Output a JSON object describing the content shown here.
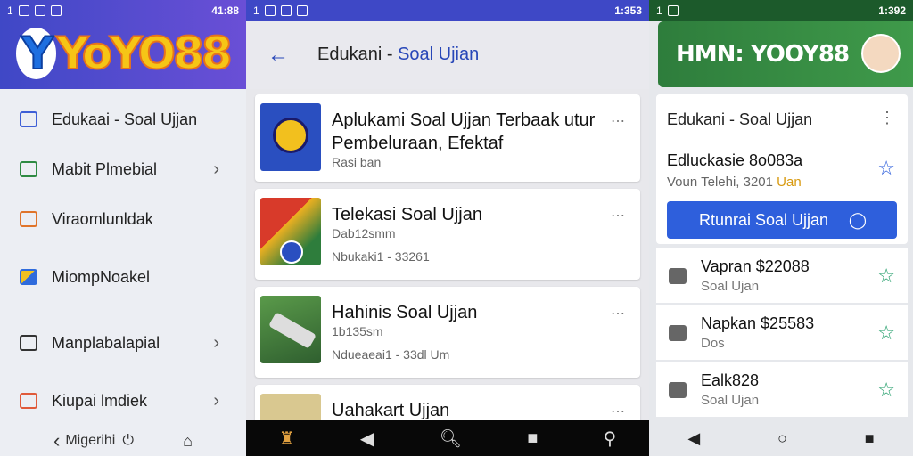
{
  "panel1": {
    "status_time": "41:88",
    "status_left": "1",
    "logo_y": "Y",
    "logo_rest": "YoYO88",
    "menu": [
      {
        "label": "Edukaai - Soal Ujjan",
        "icon": "card-icon",
        "color": "#3e5fd6"
      },
      {
        "label": "Mabit Plmebial",
        "icon": "book-icon",
        "color": "#2e8a42"
      },
      {
        "label": "Viraomlunldak",
        "icon": "folder-icon",
        "color": "#e0742a"
      },
      {
        "label": "MiompNoakel",
        "icon": "pencil-icon",
        "color": "#2f6bdc"
      },
      {
        "label": "Manplabalapial",
        "icon": "window-icon",
        "color": "#333333"
      },
      {
        "label": "Kiupai lmdiek",
        "icon": "list-icon",
        "color": "#e05a3a"
      }
    ],
    "footer_label": "Migerihi"
  },
  "panel2": {
    "status_time": "1:353",
    "status_left": "1",
    "title": "Edukani",
    "subtitle": "Soal Ujian",
    "cards": [
      {
        "title_line1": "Aplukami Soal Ujjan Terbaak utur",
        "title_line2": "Pembeluraan, Efektaf",
        "sub1": "Rasi ban",
        "sub2": ""
      },
      {
        "title_line1": "Telekasi Soal Ujjan",
        "title_line2": "",
        "sub1": "Dab12smm",
        "sub2": "Nbukaki1 - 33261"
      },
      {
        "title_line1": "Hahinis Soal Ujjan",
        "title_line2": "",
        "sub1": "1b135sm",
        "sub2": "Ndueaeai1 - 33dl Um"
      },
      {
        "title_line1": "Uahakart Ujjan",
        "title_line2": "",
        "sub1": "",
        "sub2": ""
      }
    ]
  },
  "panel3": {
    "status_time": "1:392",
    "status_left": "1",
    "banner_left": "HMN:",
    "banner_right": "YOOY88",
    "card_title": "Edukani - Soal Ujjan",
    "detail_title": "Edluckasie 8o083a",
    "detail_sub": "Voun Telehi, 3201",
    "detail_highlight": "Uan",
    "button_label": "Rtunrai Soal Ujjan",
    "rows": [
      {
        "title": "Vapran $22088",
        "sub": "Soal Ujan"
      },
      {
        "title": "Napkan $25583",
        "sub": "Dos"
      },
      {
        "title": "Ealk828",
        "sub": "Soal Ujan"
      }
    ]
  },
  "colors": {
    "primary": "#3e48c6",
    "green": "#2e7d3c",
    "accent_blue": "#2e5fdc",
    "star": "#1a9a64"
  }
}
